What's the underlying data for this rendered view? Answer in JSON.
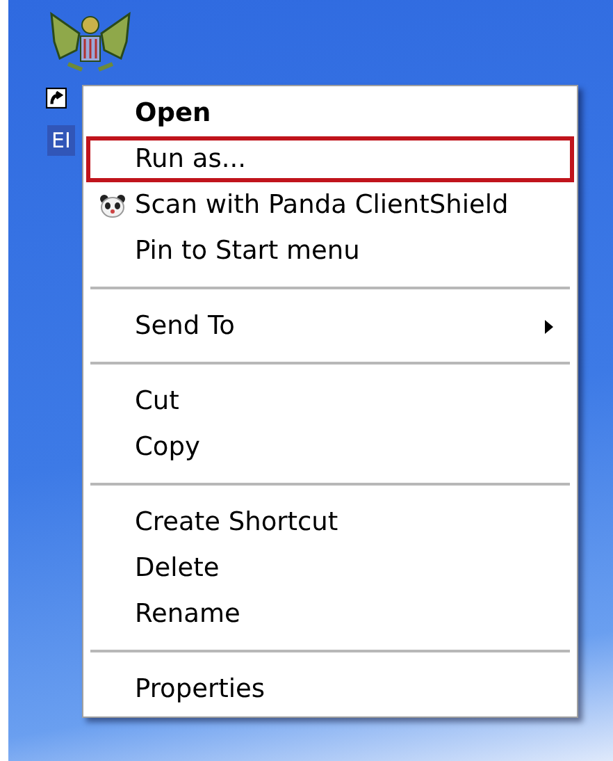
{
  "desktop_icon": {
    "label": "EI",
    "selected": true,
    "shortcut": true
  },
  "context_menu": {
    "items": [
      {
        "kind": "item",
        "label": "Open",
        "default": true,
        "highlighted": false,
        "icon": false,
        "submenu": false
      },
      {
        "kind": "item",
        "label": "Run as...",
        "default": false,
        "highlighted": true,
        "icon": false,
        "submenu": false
      },
      {
        "kind": "item",
        "label": "Scan with Panda ClientShield",
        "default": false,
        "highlighted": false,
        "icon": true,
        "submenu": false
      },
      {
        "kind": "item",
        "label": "Pin to Start menu",
        "default": false,
        "highlighted": false,
        "icon": false,
        "submenu": false
      },
      {
        "kind": "separator"
      },
      {
        "kind": "item",
        "label": "Send To",
        "default": false,
        "highlighted": false,
        "icon": false,
        "submenu": true
      },
      {
        "kind": "separator"
      },
      {
        "kind": "item",
        "label": "Cut",
        "default": false,
        "highlighted": false,
        "icon": false,
        "submenu": false
      },
      {
        "kind": "item",
        "label": "Copy",
        "default": false,
        "highlighted": false,
        "icon": false,
        "submenu": false
      },
      {
        "kind": "separator"
      },
      {
        "kind": "item",
        "label": "Create Shortcut",
        "default": false,
        "highlighted": false,
        "icon": false,
        "submenu": false
      },
      {
        "kind": "item",
        "label": "Delete",
        "default": false,
        "highlighted": false,
        "icon": false,
        "submenu": false
      },
      {
        "kind": "item",
        "label": "Rename",
        "default": false,
        "highlighted": false,
        "icon": false,
        "submenu": false
      },
      {
        "kind": "separator"
      },
      {
        "kind": "item",
        "label": "Properties",
        "default": false,
        "highlighted": false,
        "icon": false,
        "submenu": false
      }
    ]
  }
}
